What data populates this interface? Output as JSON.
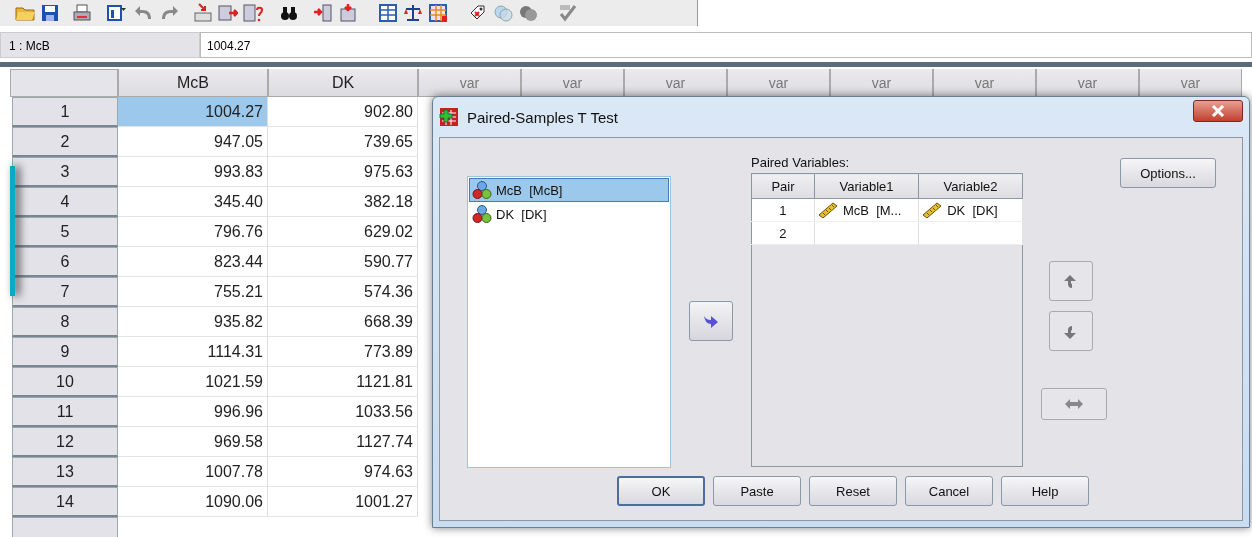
{
  "cell_editor": {
    "cell_ref": "1 : McB",
    "value": "1004.27"
  },
  "grid": {
    "columns": [
      "McB",
      "DK",
      "var",
      "var",
      "var",
      "var",
      "var",
      "var",
      "var",
      "var"
    ],
    "rows": [
      {
        "label": "1",
        "cells": [
          {
            "value": "1004.27",
            "selected": true
          },
          {
            "value": "902.80",
            "selected": false
          }
        ]
      },
      {
        "label": "2",
        "cells": [
          {
            "value": "947.05",
            "selected": false
          },
          {
            "value": "739.65",
            "selected": false
          }
        ]
      },
      {
        "label": "3",
        "cells": [
          {
            "value": "993.83",
            "selected": false
          },
          {
            "value": "975.63",
            "selected": false
          }
        ]
      },
      {
        "label": "4",
        "cells": [
          {
            "value": "345.40",
            "selected": false
          },
          {
            "value": "382.18",
            "selected": false
          }
        ]
      },
      {
        "label": "5",
        "cells": [
          {
            "value": "796.76",
            "selected": false
          },
          {
            "value": "629.02",
            "selected": false
          }
        ]
      },
      {
        "label": "6",
        "cells": [
          {
            "value": "823.44",
            "selected": false
          },
          {
            "value": "590.77",
            "selected": false
          }
        ]
      },
      {
        "label": "7",
        "cells": [
          {
            "value": "755.21",
            "selected": false
          },
          {
            "value": "574.36",
            "selected": false
          }
        ]
      },
      {
        "label": "8",
        "cells": [
          {
            "value": "935.82",
            "selected": false
          },
          {
            "value": "668.39",
            "selected": false
          }
        ]
      },
      {
        "label": "9",
        "cells": [
          {
            "value": "1114.31",
            "selected": false
          },
          {
            "value": "773.89",
            "selected": false
          }
        ]
      },
      {
        "label": "10",
        "cells": [
          {
            "value": "1021.59",
            "selected": false
          },
          {
            "value": "1121.81",
            "selected": false
          }
        ]
      },
      {
        "label": "11",
        "cells": [
          {
            "value": "996.96",
            "selected": false
          },
          {
            "value": "1033.56",
            "selected": false
          }
        ]
      },
      {
        "label": "12",
        "cells": [
          {
            "value": "969.58",
            "selected": false
          },
          {
            "value": "1127.74",
            "selected": false
          }
        ]
      },
      {
        "label": "13",
        "cells": [
          {
            "value": "1007.78",
            "selected": false
          },
          {
            "value": "974.63",
            "selected": false
          }
        ]
      },
      {
        "label": "14",
        "cells": [
          {
            "value": "1090.06",
            "selected": false
          },
          {
            "value": "1001.27",
            "selected": false
          }
        ]
      }
    ]
  },
  "dialog": {
    "title": "Paired-Samples T Test",
    "source_variables": [
      {
        "label": "McB  [McB]",
        "selected": true
      },
      {
        "label": "DK  [DK]",
        "selected": false
      }
    ],
    "move_button": {
      "disabled": false
    },
    "paired_label": "Paired Variables:",
    "pairs_table": {
      "columns": [
        "Pair",
        "Variable1",
        "Variable2"
      ],
      "rows": [
        {
          "pair": "1",
          "variable1": "McB  [M...",
          "variable2": "DK  [DK]"
        },
        {
          "pair": "2"
        }
      ]
    },
    "options_button": "Options...",
    "order_buttons": [
      {
        "kind": "up",
        "disabled": true
      },
      {
        "kind": "down",
        "disabled": true
      },
      {
        "kind": "swap",
        "disabled": true
      }
    ],
    "buttons": [
      {
        "label": "OK",
        "default": true
      },
      {
        "label": "Paste",
        "default": false
      },
      {
        "label": "Reset",
        "default": false
      },
      {
        "label": "Cancel",
        "default": false
      },
      {
        "label": "Help",
        "default": false
      }
    ]
  }
}
